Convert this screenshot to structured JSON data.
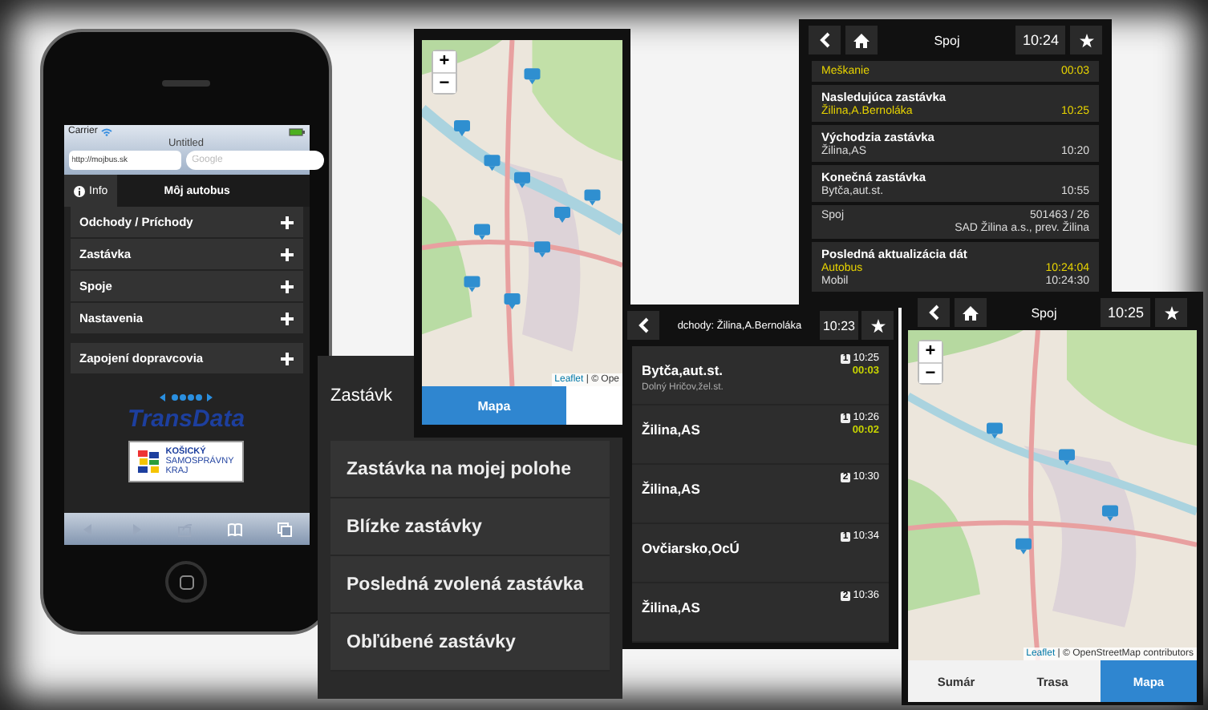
{
  "phone": {
    "carrier": "Carrier",
    "page_title": "Untitled",
    "url": "http://mojbus.sk",
    "search_placeholder": "Google",
    "info_button": "Info",
    "header_title": "Môj autobus",
    "menu": [
      {
        "label": "Odchody / Príchody"
      },
      {
        "label": "Zastávka"
      },
      {
        "label": "Spoje"
      },
      {
        "label": "Nastavenia"
      }
    ],
    "menu_extra": [
      {
        "label": "Zapojení dopravcovia"
      }
    ],
    "logo": "TransData",
    "partner_logo": [
      "KOŠICKÝ",
      "SAMOSPRÁVNY",
      "KRAJ"
    ]
  },
  "stops_panel": {
    "title": "Zastávk",
    "items": [
      {
        "label": "Zastávka na mojej polohe"
      },
      {
        "label": "Blízke zastávky"
      },
      {
        "label": "Posledná zvolená zastávka"
      },
      {
        "label": "Obľúbené zastávky"
      }
    ]
  },
  "map_panel": {
    "zoom_in": "+",
    "zoom_out": "−",
    "attribution_link": "Leaflet",
    "attribution": "| © Ope",
    "tabs": [
      {
        "label": "Mapa",
        "selected": true
      }
    ]
  },
  "trip_panel": {
    "title": "Spoj",
    "time": "10:24",
    "rows": [
      {
        "lines": [
          {
            "kind": "plain",
            "label": "Meškanie",
            "value": "00:03",
            "highlight": true
          }
        ]
      },
      {
        "lines": [
          {
            "kind": "heading",
            "label": "Nasledujúca zastávka",
            "highlight": false
          },
          {
            "kind": "plain",
            "label": "Žilina,A.Bernoláka",
            "value": "10:25",
            "highlight": true
          }
        ]
      },
      {
        "lines": [
          {
            "kind": "heading",
            "label": "Východzia zastávka",
            "highlight": false
          },
          {
            "kind": "plain",
            "label": "Žilina,AS",
            "value": "10:20",
            "highlight": false
          }
        ]
      },
      {
        "lines": [
          {
            "kind": "heading",
            "label": "Konečná zastávka",
            "highlight": false
          },
          {
            "kind": "plain",
            "label": "Bytča,aut.st.",
            "value": "10:55",
            "highlight": false
          }
        ]
      },
      {
        "lines": [
          {
            "kind": "plain",
            "label": "Spoj",
            "value": "501463 / 26",
            "highlight": false
          },
          {
            "kind": "plain",
            "value": "SAD Žilina a.s., prev. Žilina",
            "highlight": false
          }
        ]
      },
      {
        "lines": [
          {
            "kind": "heading",
            "label": "Posledná aktualizácia dát",
            "highlight": false
          },
          {
            "kind": "plain",
            "label": "Autobus",
            "value": "10:24:04",
            "highlight": true
          },
          {
            "kind": "plain",
            "label": "Mobil",
            "value": "10:24:30",
            "highlight": false
          }
        ]
      }
    ]
  },
  "departures_panel": {
    "title": "dchody: Žilina,A.Bernoláka",
    "time": "10:23",
    "items": [
      {
        "stop": "Bytča,aut.st.",
        "subtitle": "Dolný Hričov,žel.st.",
        "platform": "1",
        "time": "10:25",
        "delay": "00:03"
      },
      {
        "stop": "Žilina,AS",
        "platform": "1",
        "time": "10:26",
        "delay": "00:02"
      },
      {
        "stop": "Žilina,AS",
        "platform": "2",
        "time": "10:30"
      },
      {
        "stop": "Ovčiarsko,OcÚ",
        "platform": "1",
        "time": "10:34"
      },
      {
        "stop": "Žilina,AS",
        "platform": "2",
        "time": "10:36"
      }
    ]
  },
  "route_map_panel": {
    "title": "Spoj",
    "time": "10:25",
    "zoom_in": "+",
    "zoom_out": "−",
    "attribution_link": "Leaflet",
    "attribution": "| © OpenStreetMap contributors",
    "tabs": [
      {
        "label": "Sumár",
        "selected": false
      },
      {
        "label": "Trasa",
        "selected": false
      },
      {
        "label": "Mapa",
        "selected": true
      }
    ]
  }
}
